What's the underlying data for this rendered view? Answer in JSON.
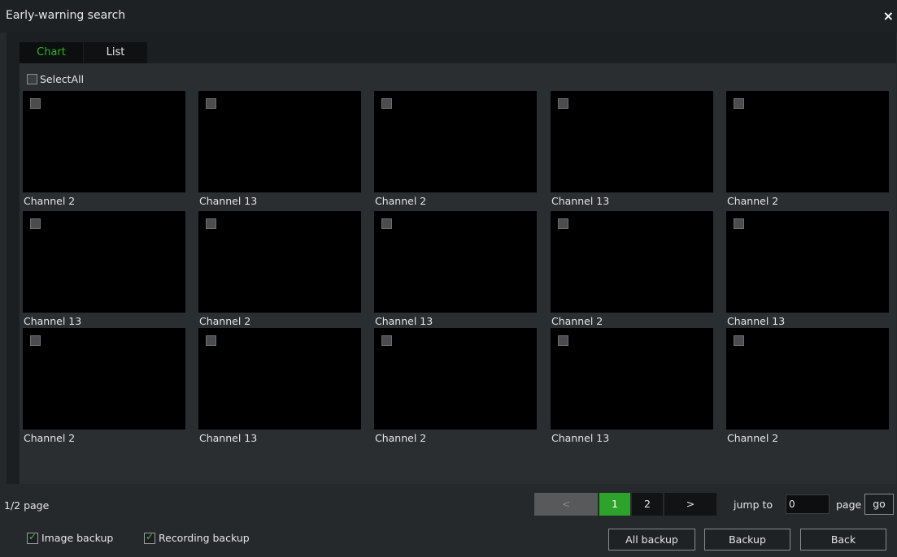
{
  "window": {
    "title": "Early-warning search",
    "close_icon": "×"
  },
  "tabs": [
    {
      "label": "Chart",
      "active": true
    },
    {
      "label": "List",
      "active": false
    }
  ],
  "select_all": {
    "label": "SelectAll",
    "checked": false
  },
  "thumbnails": [
    "Channel 2",
    "Channel 13",
    "Channel 2",
    "Channel 13",
    "Channel 2",
    "Channel 13",
    "Channel 2",
    "Channel 13",
    "Channel 2",
    "Channel 13",
    "Channel 2",
    "Channel 13",
    "Channel 2",
    "Channel 13",
    "Channel 2"
  ],
  "pagination": {
    "page_info": "1/2 page",
    "prev": "<",
    "pages": [
      "1",
      "2"
    ],
    "current_page": "1",
    "next": ">",
    "jump_label": "jump to",
    "jump_value": "0",
    "page_label": "page",
    "go_label": "go"
  },
  "options": {
    "image_backup": {
      "label": "Image backup",
      "checked": true
    },
    "recording_backup": {
      "label": "Recording backup",
      "checked": true
    }
  },
  "actions": {
    "all_backup": "All backup",
    "backup": "Backup",
    "back": "Back"
  },
  "colors": {
    "accent_green": "#2ea32b",
    "active_tab_text": "#33b02a"
  }
}
